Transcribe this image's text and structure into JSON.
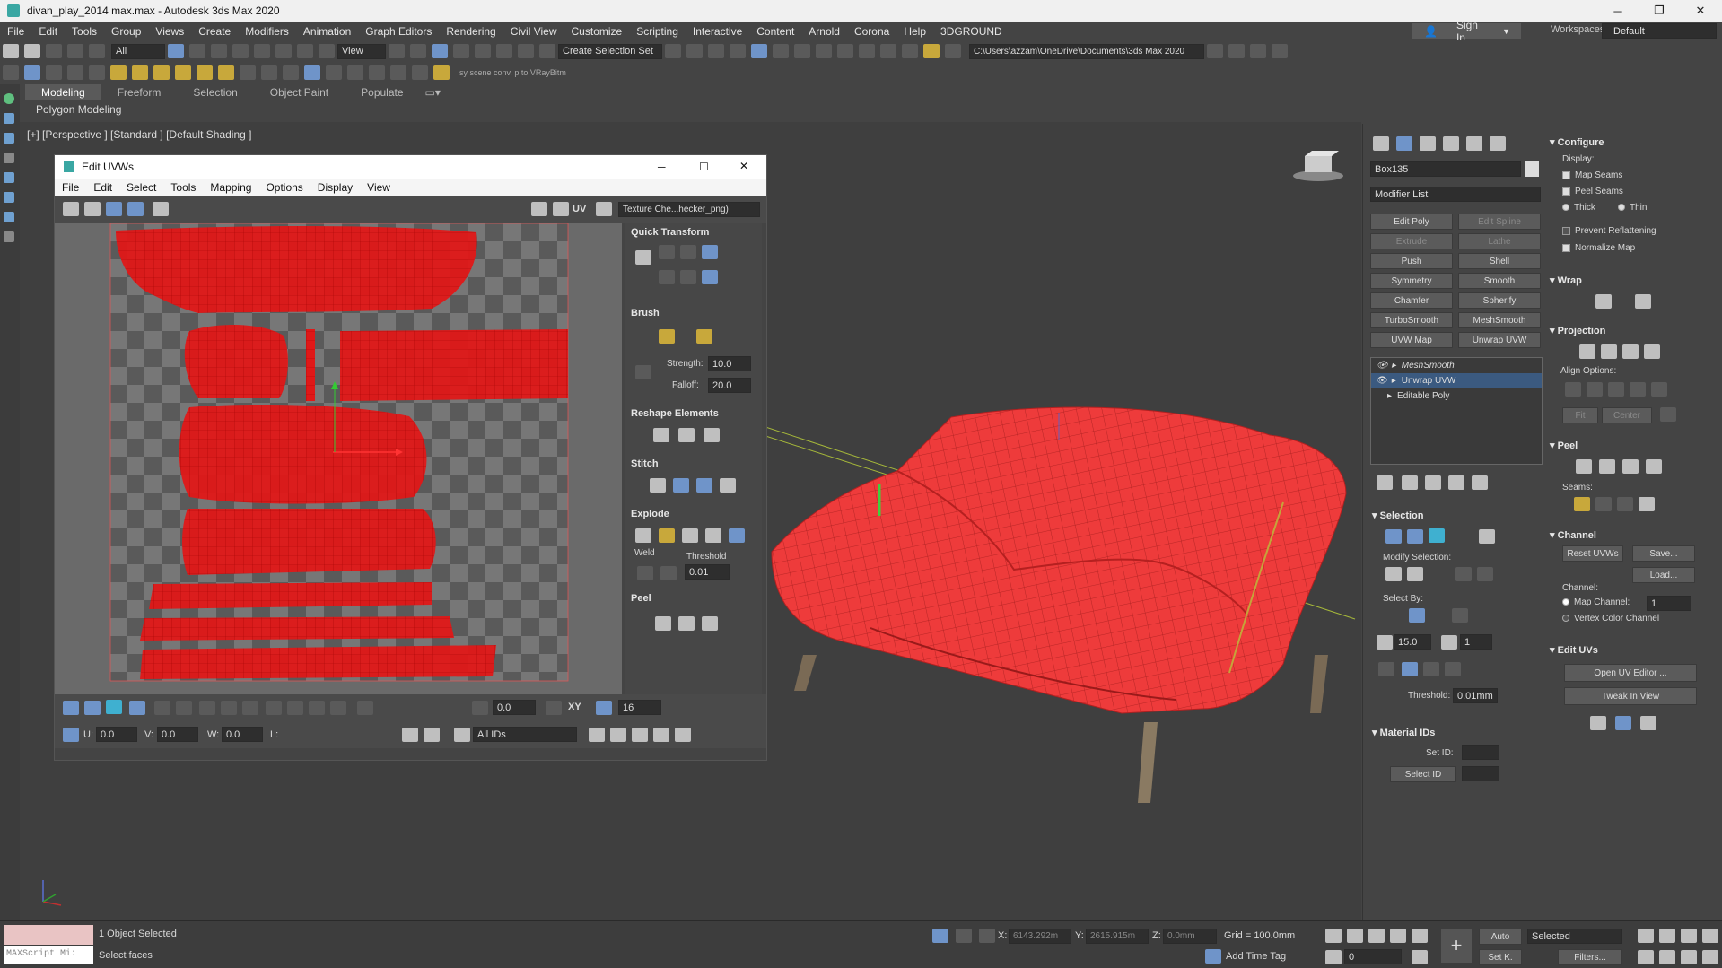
{
  "window": {
    "title": "divan_play_2014 max.max - Autodesk 3ds Max 2020",
    "minimize": "─",
    "maximize": "❐",
    "close": "✕"
  },
  "menubar": [
    "File",
    "Edit",
    "Tools",
    "Group",
    "Views",
    "Create",
    "Modifiers",
    "Animation",
    "Graph Editors",
    "Rendering",
    "Civil View",
    "Customize",
    "Scripting",
    "Interactive",
    "Content",
    "Arnold",
    "Corona",
    "Help",
    "3DGROUND"
  ],
  "account": {
    "sign_in": "Sign In",
    "workspaces_label": "Workspaces:",
    "workspace_value": "Default"
  },
  "toolbar1": {
    "selection_filter": "All",
    "view_dropdown": "View",
    "create_selection_set": "Create Selection Set",
    "project_path": "C:\\Users\\azzam\\OneDrive\\Documents\\3ds Max 2020"
  },
  "toolbar2": {
    "script_hint": "sy scene conv. p to VRayBitm"
  },
  "ribbon": {
    "tabs": [
      "Modeling",
      "Freeform",
      "Selection",
      "Object Paint",
      "Populate"
    ],
    "active_tab": "Modeling",
    "sub_label": "Polygon Modeling"
  },
  "viewport": {
    "label": "[+] [Perspective ] [Standard ] [Default Shading ]"
  },
  "uvw_editor": {
    "title": "Edit UVWs",
    "menu": [
      "File",
      "Edit",
      "Select",
      "Tools",
      "Mapping",
      "Options",
      "Display",
      "View"
    ],
    "uv_label": "UV",
    "texture_dropdown": "Texture Che...hecker_png)",
    "rollouts": {
      "quick_transform": "Quick Transform",
      "brush": "Brush",
      "strength_label": "Strength:",
      "strength_value": "10.0",
      "falloff_label": "Falloff:",
      "falloff_value": "20.0",
      "reshape": "Reshape Elements",
      "stitch": "Stitch",
      "explode": "Explode",
      "weld_label": "Weld",
      "threshold_label": "Threshold",
      "threshold_value": "0.01",
      "peel": "Peel"
    },
    "bottom": {
      "rotate_value": "0.0",
      "xy_label": "XY",
      "grid_value": "16",
      "u_label": "U:",
      "u_value": "0.0",
      "v_label": "V:",
      "v_value": "0.0",
      "w_label": "W:",
      "w_value": "0.0",
      "l_label": "L:",
      "ids_dropdown": "All IDs"
    }
  },
  "command_panel": {
    "object_name": "Box135",
    "modifier_list": "Modifier List",
    "modifier_buttons": [
      [
        "Edit Poly",
        "Edit Spline"
      ],
      [
        "Extrude",
        "Lathe"
      ],
      [
        "Push",
        "Shell"
      ],
      [
        "Symmetry",
        "Smooth"
      ],
      [
        "Chamfer",
        "Spherify"
      ],
      [
        "TurboSmooth",
        "MeshSmooth"
      ],
      [
        "UVW Map",
        "Unwrap UVW"
      ]
    ],
    "stack": [
      "MeshSmooth",
      "Unwrap UVW",
      "Editable Poly"
    ],
    "selection": {
      "title": "Selection",
      "modify_selection": "Modify Selection:",
      "select_by": "Select By:",
      "angle_value": "15.0",
      "count_value": "1",
      "threshold_label": "Threshold:",
      "threshold_value": "0.01mm"
    },
    "material_ids": {
      "title": "Material IDs",
      "set_id_label": "Set ID:",
      "select_id": "Select ID"
    },
    "configure": {
      "title": "Configure",
      "display_label": "Display:",
      "map_seams": "Map Seams",
      "peel_seams": "Peel Seams",
      "thick": "Thick",
      "thin": "Thin",
      "prevent_reflattening": "Prevent Reflattening",
      "normalize_map": "Normalize Map"
    },
    "wrap": {
      "title": "Wrap"
    },
    "projection": {
      "title": "Projection",
      "align_options": "Align Options:",
      "fit": "Fit",
      "center": "Center"
    },
    "peel": {
      "title": "Peel",
      "seams": "Seams:"
    },
    "channel": {
      "title": "Channel",
      "reset_uvws": "Reset UVWs",
      "save": "Save...",
      "load": "Load...",
      "channel_label": "Channel:",
      "map_channel": "Map Channel:",
      "map_channel_value": "1",
      "vertex_color_channel": "Vertex Color Channel"
    },
    "edit_uvs": {
      "title": "Edit UVs",
      "open_uv_editor": "Open UV Editor ...",
      "tweak_in_view": "Tweak In View"
    }
  },
  "statusbar": {
    "maxscript": "MAXScript Mi:",
    "objects_selected": "1 Object Selected",
    "prompt": "Select faces",
    "x_label": "X:",
    "x_value": "6143.292m",
    "y_label": "Y:",
    "y_value": "2615.915m",
    "z_label": "Z:",
    "z_value": "0.0mm",
    "grid": "Grid = 100.0mm",
    "add_time_tag": "Add Time Tag",
    "auto": "Auto",
    "set_k": "Set K.",
    "selected_dropdown": "Selected",
    "filters": "Filters...",
    "frame_value": "0"
  }
}
